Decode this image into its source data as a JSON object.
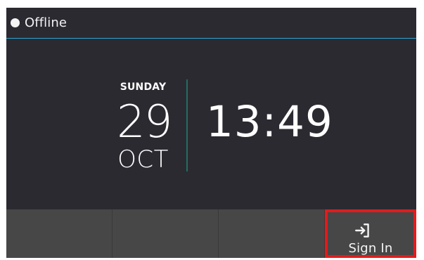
{
  "status": {
    "indicator_icon": "status-dot-icon",
    "text": "Offline",
    "accent_color": "#2aa6d6"
  },
  "clock": {
    "weekday": "SUNDAY",
    "day": "29",
    "month": "OCT",
    "time": "13:49"
  },
  "bottom_bar": {
    "buttons": [
      {
        "label": ""
      },
      {
        "label": ""
      },
      {
        "label": ""
      },
      {
        "label": "Sign In",
        "icon": "sign-in-icon"
      }
    ]
  }
}
